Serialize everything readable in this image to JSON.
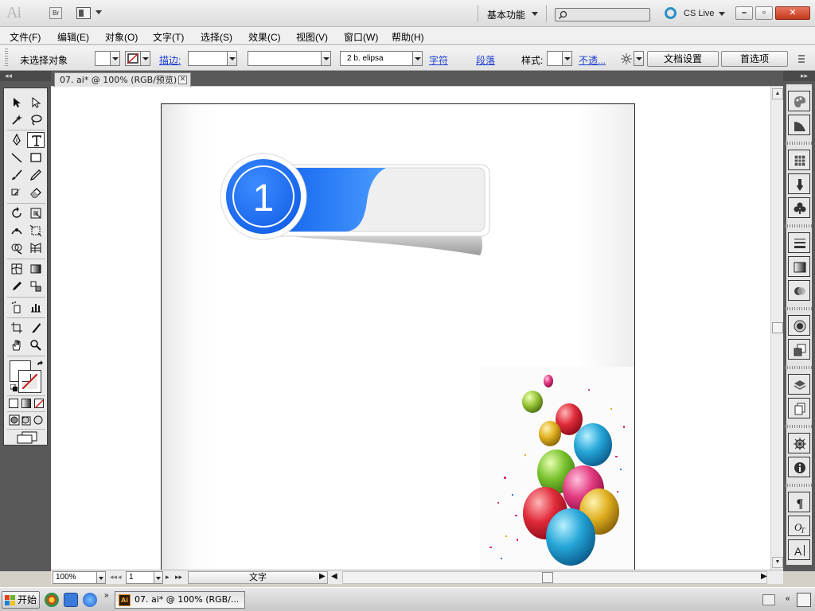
{
  "titlebar": {
    "app_logo": "Ai",
    "bridge_label": "Br",
    "workspace": "基本功能",
    "cslive": "CS Live",
    "minimize": "–",
    "restore": "▫",
    "close": "✕"
  },
  "menu": [
    "文件(F)",
    "编辑(E)",
    "对象(O)",
    "文字(T)",
    "选择(S)",
    "效果(C)",
    "视图(V)",
    "窗口(W)",
    "帮助(H)"
  ],
  "control": {
    "selection_status": "未选择对象",
    "stroke_label": "描边:",
    "font_name": "2 b. elipsa",
    "char_link": "字符",
    "para_link": "段落",
    "style_label": "样式:",
    "opacity_link": "不透...",
    "doc_setup_button": "文档设置",
    "prefs_button": "首选项"
  },
  "document": {
    "tab_title": "07. ai* @ 100% (RGB/预览)"
  },
  "artwork": {
    "badge_number": "1",
    "accent_color": "#2a7af4"
  },
  "status": {
    "zoom": "100%",
    "page": "1",
    "info": "文字"
  },
  "taskbar": {
    "start_label": "开始",
    "task_label": "07. ai* @ 100% (RGB/..."
  },
  "colors": {
    "panel_bg": "#595959",
    "link": "#1c3fd1"
  }
}
